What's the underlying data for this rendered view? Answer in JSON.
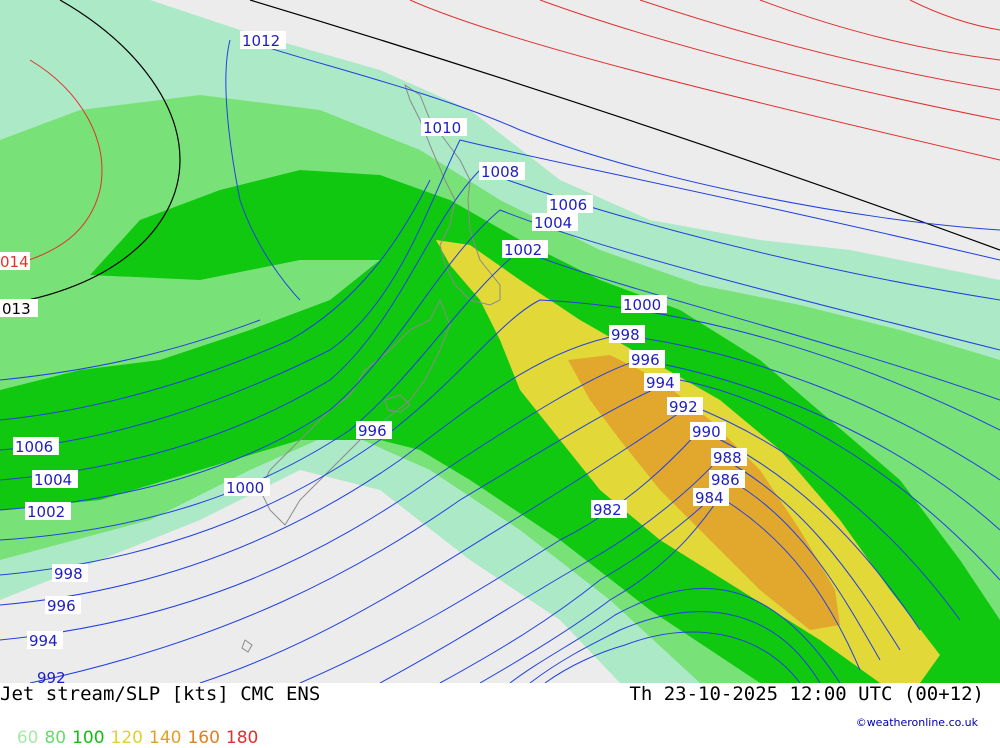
{
  "title": "Jet stream/SLP [kts] CMC ENS",
  "datetime": "Th 23-10-2025 12:00 UTC (00+12)",
  "credit": "©weatheronline.co.uk",
  "legend": [
    {
      "label": "60",
      "color": "#a8e8a8"
    },
    {
      "label": "80",
      "color": "#6cd86c"
    },
    {
      "label": "100",
      "color": "#10c010"
    },
    {
      "label": "120",
      "color": "#e0d030"
    },
    {
      "label": "140",
      "color": "#e0a020"
    },
    {
      "label": "160",
      "color": "#e08020"
    },
    {
      "label": "180",
      "color": "#e03030"
    }
  ],
  "isobar_labels": {
    "l1012": "1012",
    "l1010": "1010",
    "l1008": "1008",
    "l1006": "1006",
    "l1004": "1004",
    "l1002": "1002",
    "l1000": "1000",
    "l998": "998",
    "l996": "996",
    "l994": "994",
    "l992": "992",
    "l990": "990",
    "l988": "988",
    "l986": "986",
    "l984": "984",
    "l982": "982",
    "l1014red": "014",
    "l1013black": "013",
    "w1006": "1006",
    "w1004": "1004",
    "w1002": "1002",
    "w1000": "1000",
    "w998": "998",
    "w996": "996",
    "w994": "994",
    "w992": "992",
    "c996": "996"
  }
}
